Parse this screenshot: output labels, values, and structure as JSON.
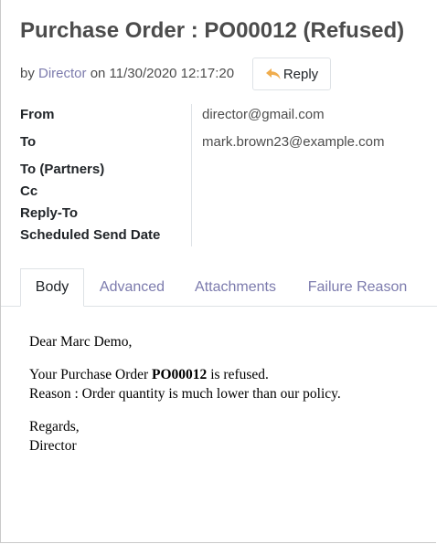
{
  "header": {
    "title": "Purchase Order : PO00012 (Refused)",
    "by_prefix": "by",
    "author": "Director",
    "on_text": "on 11/30/2020 12:17:20",
    "reply_label": "Reply",
    "reply_icon": "reply-arrow-icon",
    "accent_color": "#7c7bad",
    "icon_color": "#f0ad4e"
  },
  "fields": [
    {
      "label": "From",
      "value": "director@gmail.com"
    },
    {
      "label": "To",
      "value": "mark.brown23@example.com"
    },
    {
      "label": "To (Partners)",
      "value": ""
    },
    {
      "label": "Cc",
      "value": ""
    },
    {
      "label": "Reply-To",
      "value": ""
    },
    {
      "label": "Scheduled Send Date",
      "value": ""
    }
  ],
  "tabs": [
    {
      "label": "Body",
      "active": true
    },
    {
      "label": "Advanced",
      "active": false
    },
    {
      "label": "Attachments",
      "active": false
    },
    {
      "label": "Failure Reason",
      "active": false
    }
  ],
  "body": {
    "greeting": "Dear Marc Demo,",
    "line1_prefix": "Your Purchase Order ",
    "line1_bold": "PO00012",
    "line1_suffix": " is refused.",
    "line2": "Reason : Order quantity is much lower than our policy.",
    "closing": "Regards,",
    "signature": "Director"
  }
}
